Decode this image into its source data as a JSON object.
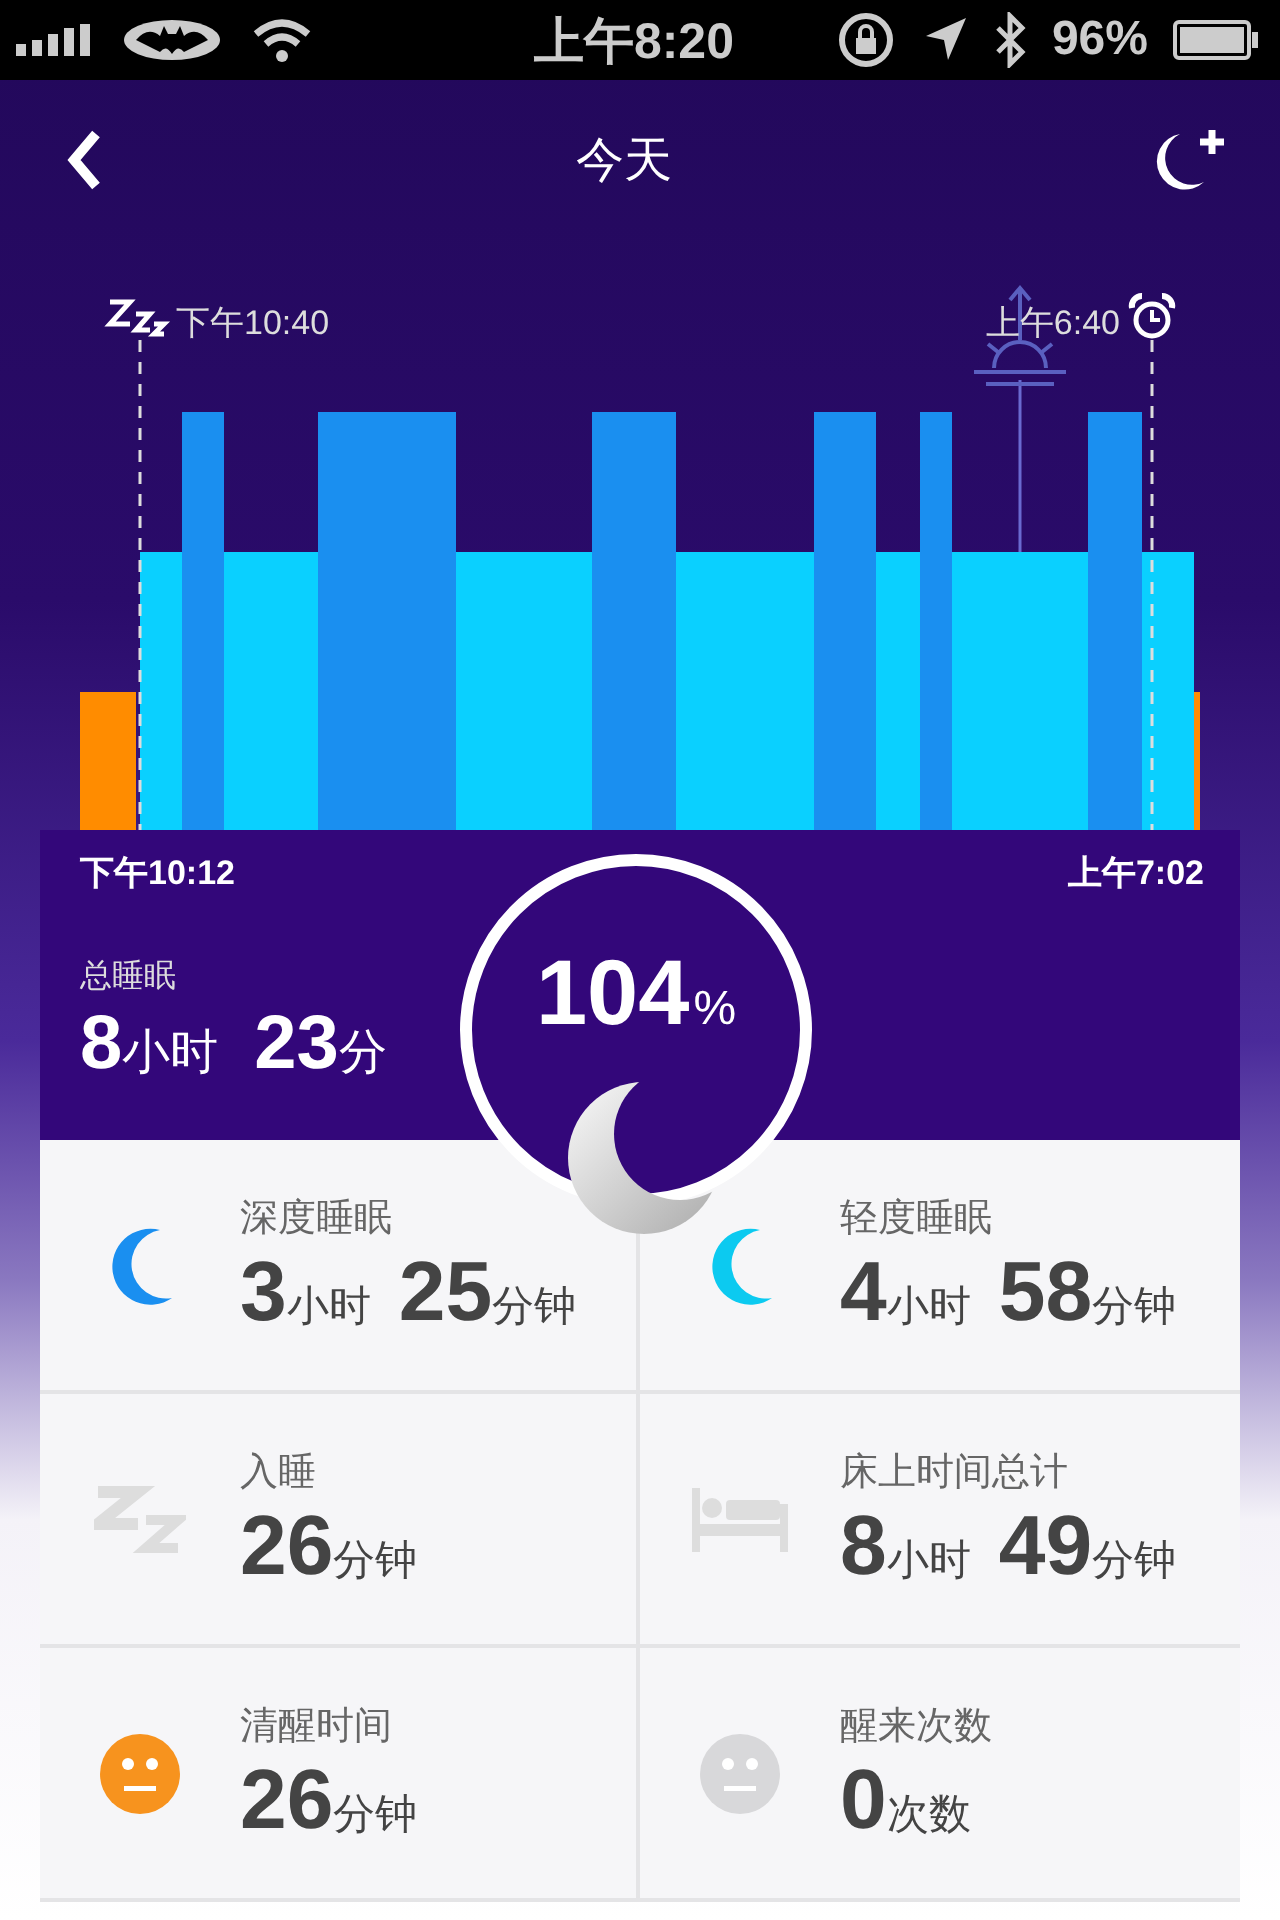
{
  "status_bar": {
    "time": "上午8:20",
    "battery": "96%"
  },
  "nav": {
    "title": "今天"
  },
  "chart": {
    "bedtime_label": "下午10:40",
    "alarm_label": "上午6:40",
    "start": "下午10:12",
    "end": "上午7:02"
  },
  "total": {
    "label": "总睡眠",
    "parts": [
      {
        "number": "8",
        "unit": "小时"
      },
      {
        "number": "23",
        "unit": "分"
      }
    ],
    "percent": "104",
    "percent_sign": "%"
  },
  "stats": [
    {
      "kind": "moon",
      "color": "#1a8ff0",
      "label": "深度睡眠",
      "parts": [
        {
          "number": "3",
          "unit": "小时"
        },
        {
          "number": "25",
          "unit": "分钟"
        }
      ]
    },
    {
      "kind": "moon",
      "color": "#0ccaf0",
      "label": "轻度睡眠",
      "parts": [
        {
          "number": "4",
          "unit": "小时"
        },
        {
          "number": "58",
          "unit": "分钟"
        }
      ]
    },
    {
      "kind": "zzz",
      "label": "入睡",
      "parts": [
        {
          "number": "26",
          "unit": "分钟"
        }
      ]
    },
    {
      "kind": "bed",
      "label": "床上时间总计",
      "parts": [
        {
          "number": "8",
          "unit": "小时"
        },
        {
          "number": "49",
          "unit": "分钟"
        }
      ]
    },
    {
      "kind": "face",
      "color": "#f7931e",
      "label": "清醒时间",
      "parts": [
        {
          "number": "26",
          "unit": "分钟"
        }
      ]
    },
    {
      "kind": "face",
      "color": "#d8d8da",
      "label": "醒来次数",
      "parts": [
        {
          "number": "0",
          "unit": "次数"
        }
      ]
    }
  ]
}
